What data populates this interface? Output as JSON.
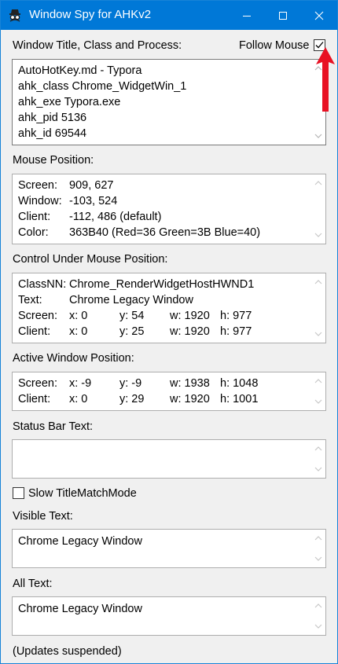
{
  "window": {
    "title": "Window Spy for AHKv2"
  },
  "sections": {
    "window_title_label": "Window Title, Class and Process:",
    "follow_mouse_label": "Follow Mouse",
    "follow_mouse_checked": true,
    "mouse_position_label": "Mouse Position:",
    "control_label": "Control Under Mouse Position:",
    "active_window_label": "Active Window Position:",
    "status_bar_label": "Status Bar Text:",
    "slow_title_label": "Slow TitleMatchMode",
    "slow_title_checked": false,
    "visible_text_label": "Visible Text:",
    "all_text_label": "All Text:",
    "footer_status": "(Updates suspended)"
  },
  "window_info": {
    "line1": "AutoHotKey.md - Typora",
    "line2": "ahk_class Chrome_WidgetWin_1",
    "line3": "ahk_exe Typora.exe",
    "line4": "ahk_pid 5136",
    "line5": "ahk_id 69544"
  },
  "mouse": {
    "screen_label": "Screen:",
    "screen_value": "909, 627",
    "window_label": "Window:",
    "window_value": "-103, 524",
    "client_label": "Client:",
    "client_value": "-112, 486 (default)",
    "color_label": "Color:",
    "color_value": "363B40 (Red=36 Green=3B Blue=40)"
  },
  "control": {
    "classnn_label": "ClassNN:",
    "classnn_value": "Chrome_RenderWidgetHostHWND1",
    "text_label": "Text:",
    "text_value": "Chrome Legacy Window",
    "screen_label": "Screen:",
    "screen_x": "x: 0",
    "screen_y": "y: 54",
    "screen_w": "w: 1920",
    "screen_h": "h: 977",
    "client_label": "Client:",
    "client_x": "x: 0",
    "client_y": "y: 25",
    "client_w": "w: 1920",
    "client_h": "h: 977"
  },
  "active": {
    "screen_label": "Screen:",
    "screen_x": "x: -9",
    "screen_y": "y: -9",
    "screen_w": "w: 1938",
    "screen_h": "h: 1048",
    "client_label": "Client:",
    "client_x": "x: 0",
    "client_y": "y: 29",
    "client_w": "w: 1920",
    "client_h": "h: 1001"
  },
  "status_bar_text": "",
  "visible_text": "Chrome Legacy Window",
  "all_text": "Chrome Legacy Window",
  "colors": {
    "titlebar": "#0078d7",
    "annotation_arrow": "#e81123"
  },
  "icons": {
    "app": "spy-icon",
    "minimize": "minimize-icon",
    "maximize": "maximize-icon",
    "close": "close-icon"
  }
}
